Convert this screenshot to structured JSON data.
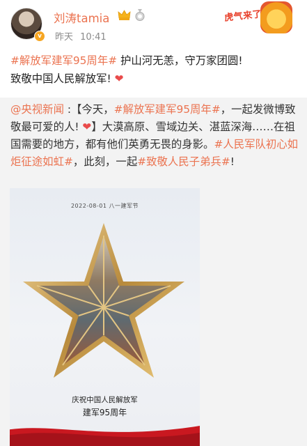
{
  "user": {
    "name": "刘涛tamia",
    "time_label": "昨天",
    "time_value": "10:41"
  },
  "festive_badge": {
    "text": "虎气来了"
  },
  "post": {
    "hashtag": "#解放军建军95周年#",
    "line1_rest": " 护山河无恙，守万家团圆!",
    "line2": "致敬中国人民解放军!",
    "heart": "❤"
  },
  "repost": {
    "mention": "@央视新闻",
    "seg1": " :【今天，",
    "tag1": "#解放军建军95周年#",
    "seg2": "，一起发微博致敬最可爱的人! ",
    "heart": "❤",
    "seg3": "】大漠高原、雪域边关、湛蓝深海……在祖国需要的地方，都有他们英勇无畏的身影。",
    "tag2": "#人民军队初心如炬征途如虹#",
    "seg4": "，此刻，一起",
    "tag3": "#致敬人民子弟兵#",
    "seg5": "!"
  },
  "poster": {
    "date_line": "2022-08-01  八一建军节",
    "caption1": "庆祝中国人民解放军",
    "caption2": "建军95周年"
  },
  "colors": {
    "accent": "#eb7350",
    "repost_bg": "#f3f3f3",
    "username": "#eb7350"
  }
}
